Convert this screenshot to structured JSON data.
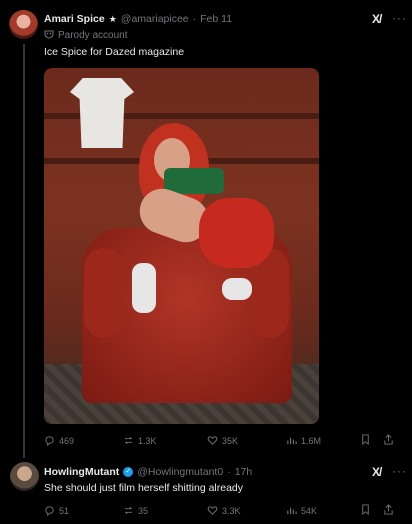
{
  "tweet1": {
    "display_name": "Amari Spice",
    "handle": "@amariapicee",
    "date": "Feb 11",
    "badge_label": "Parody account",
    "text": "Ice Spice for Dazed magazine",
    "stats": {
      "replies": "469",
      "reposts": "1.3K",
      "likes": "35K",
      "views": "1.6M"
    }
  },
  "tweet2": {
    "display_name": "HowlingMutant",
    "handle": "@Howlingmutant0",
    "time": "17h",
    "text": "She should just film herself shitting already",
    "stats": {
      "replies": "51",
      "reposts": "35",
      "likes": "3.3K",
      "views": "54K"
    }
  },
  "icons": [
    "grok-icon",
    "more-icon",
    "reply-icon",
    "repost-icon",
    "like-icon",
    "views-icon",
    "bookmark-icon",
    "share-icon",
    "parody-mask-icon",
    "verified-badge-icon"
  ],
  "colors": {
    "background": "#000000",
    "text": "#e7e9ea",
    "muted": "#71767b",
    "verified": "#1d9bf0"
  }
}
